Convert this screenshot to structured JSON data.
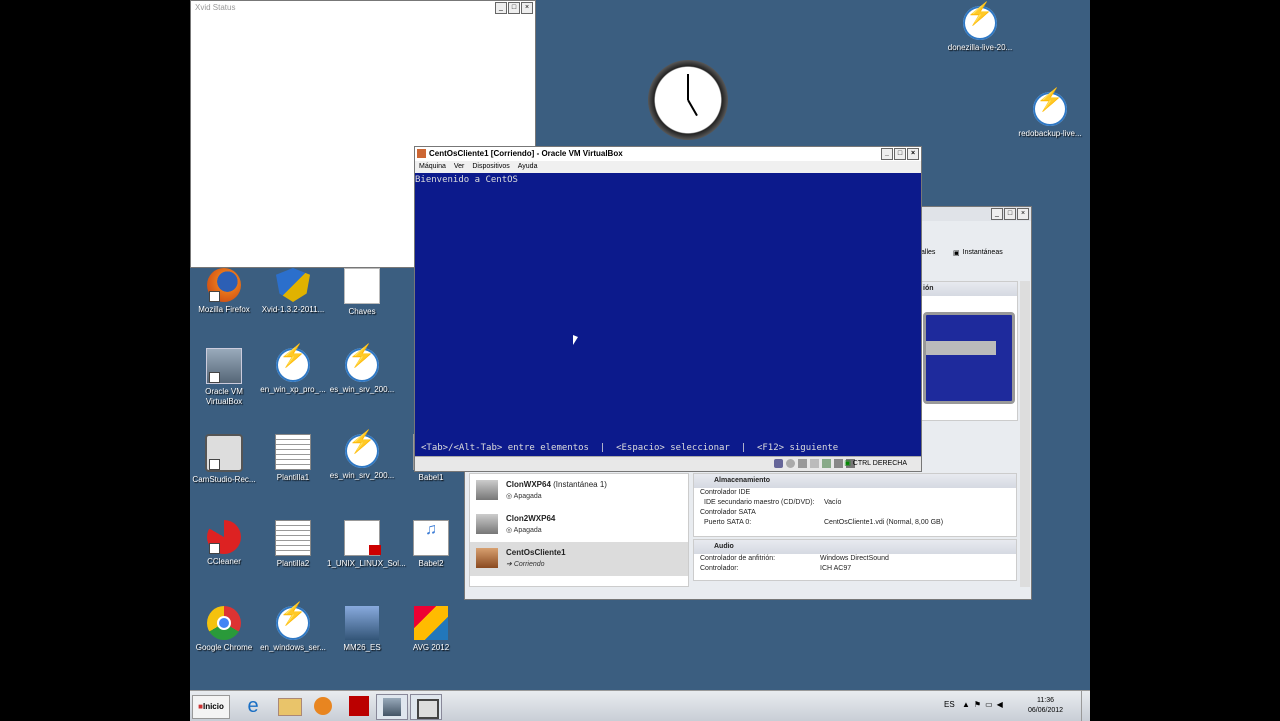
{
  "desktop_icons": [
    {
      "label": "donezilla-live-20...",
      "icon": "bolt-icon"
    },
    {
      "label": "redobackup-live...",
      "icon": "bolt-icon"
    },
    {
      "label": "Mozilla Firefox",
      "icon": "firefox-icon"
    },
    {
      "label": "Xvid-1.3.2-2011...",
      "icon": "xvid-shield-icon"
    },
    {
      "label": "Chaves",
      "icon": "document-icon"
    },
    {
      "label": "Oracle VM VirtualBox",
      "icon": "virtualbox-icon"
    },
    {
      "label": "en_win_xp_pro_...",
      "icon": "bolt-icon"
    },
    {
      "label": "es_win_srv_200...",
      "icon": "bolt-icon"
    },
    {
      "label": "CamStudio-Rec...",
      "icon": "camstudio-icon"
    },
    {
      "label": "Plantilla1",
      "icon": "document-lines-icon"
    },
    {
      "label": "es_win_srv_200...",
      "icon": "bolt-icon"
    },
    {
      "label": "Babel1",
      "icon": "wma-icon"
    },
    {
      "label": "CCleaner",
      "icon": "ccleaner-icon"
    },
    {
      "label": "Plantilla2",
      "icon": "document-lines-icon"
    },
    {
      "label": "1_UNIX_LINUX_Sol...",
      "icon": "pdf-icon"
    },
    {
      "label": "Babel2",
      "icon": "wma-icon"
    },
    {
      "label": "Google Chrome",
      "icon": "chrome-icon"
    },
    {
      "label": "en_windows_ser...",
      "icon": "bolt-icon"
    },
    {
      "label": "MM26_ES",
      "icon": "mm-icon"
    },
    {
      "label": "AVG 2012",
      "icon": "avg-icon"
    }
  ],
  "xvid": {
    "title": "Xvid Status"
  },
  "vbox": {
    "title": "CentOsCliente1 [Corriendo] - Oracle VM VirtualBox",
    "menu": [
      "Máquina",
      "Ver",
      "Dispositivos",
      "Ayuda"
    ],
    "console_top": "Bienvenido a CentOS",
    "console_bottom": "<Tab>/<Alt-Tab> entre elementos  |  <Espacio> seleccionar  |  <F12> siguiente",
    "host_key": "CTRL DERECHA"
  },
  "manager": {
    "tab_details": "alles",
    "tab_snapshots": "Instantáneas",
    "preview_header": "ión",
    "vms": [
      {
        "name": "ClonWXP64",
        "note": " (Instantánea 1)",
        "state": "Apagada"
      },
      {
        "name": "Clon2WXP64",
        "note": "",
        "state": "Apagada"
      },
      {
        "name": "CentOsCliente1",
        "note": "",
        "state": "Corriendo"
      }
    ],
    "storage": {
      "title": "Almacenamiento",
      "rows": [
        {
          "k": "Controlador IDE",
          "v": ""
        },
        {
          "k": "  IDE secundario maestro (CD/DVD):",
          "v": "Vacío"
        },
        {
          "k": "Controlador SATA",
          "v": ""
        },
        {
          "k": "  Puerto SATA 0:",
          "v": "CentOsCliente1.vdi (Normal, 8,00 GB)"
        }
      ]
    },
    "audio": {
      "title": "Audio",
      "rows": [
        {
          "k": "Controlador de anfitrión:",
          "v": "Windows DirectSound"
        },
        {
          "k": "Controlador:",
          "v": "ICH AC97"
        }
      ]
    }
  },
  "taskbar": {
    "start": "Inicio",
    "lang": "ES",
    "time": "11:36",
    "date": "06/06/2012"
  }
}
